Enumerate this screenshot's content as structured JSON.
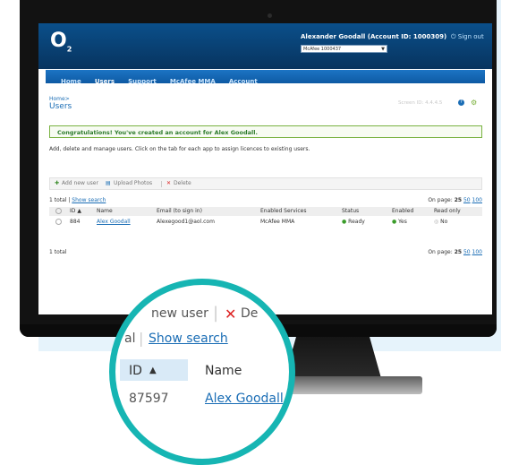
{
  "colors": {
    "header_bg": "#08345f",
    "nav_bg": "#1c74c4",
    "link": "#1a6db5",
    "success_border": "#79b241",
    "accent_teal": "#16b5b3"
  },
  "header": {
    "logo": "O",
    "logo_sub": "2",
    "user_title": "Alexander Goodall (Account ID: 1000309)",
    "signout": "Sign out",
    "account_select": "McAfee 1000437"
  },
  "nav": {
    "items": [
      "Home",
      "Users",
      "Support",
      "McAfee MMA",
      "Account"
    ],
    "active": "Users"
  },
  "page": {
    "breadcrumb": "Home>",
    "title": "Users",
    "screen_id": "Screen ID: 4.4.4.5",
    "success_message": "Congratulations! You've created an account for Alex Goodall.",
    "description": "Add, delete and manage users. Click on the tab for each app to assign licences to existing users."
  },
  "toolbar": {
    "add_user": "Add new user",
    "upload_photos": "Upload Photos",
    "delete": "Delete"
  },
  "list": {
    "total": "1 total",
    "show_search": "Show search",
    "on_page": "On page:",
    "page_sizes": [
      "25",
      "50",
      "100"
    ],
    "columns": [
      "ID",
      "Name",
      "Email (to sign in)",
      "Enabled Services",
      "Status",
      "Enabled",
      "Read only"
    ],
    "rows": [
      {
        "id": "884",
        "name": "Alex Goodall",
        "email": "Alexegood1@aol.com",
        "services": "McAfee MMA",
        "status": "Ready",
        "enabled": "Yes",
        "readonly": "No"
      }
    ],
    "footer_total": "1 total"
  },
  "zoom": {
    "partial_user": "new user",
    "partial_delete": "De",
    "partial_total": "al",
    "show_search": "Show search",
    "id_header": "ID",
    "name_header": "Name",
    "row_id": "87597",
    "row_name": "Alex Goodall"
  }
}
